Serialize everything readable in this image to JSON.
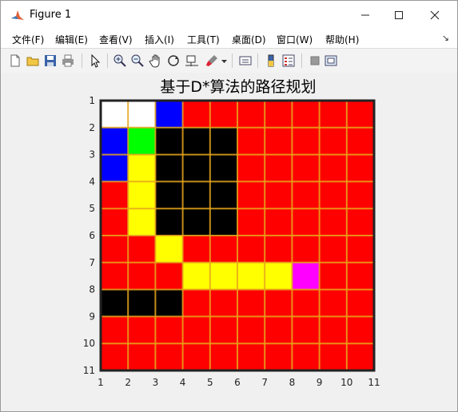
{
  "window": {
    "title": "Figure 1"
  },
  "menu": [
    "文件(F)",
    "编辑(E)",
    "查看(V)",
    "插入(I)",
    "工具(T)",
    "桌面(D)",
    "窗口(W)",
    "帮助(H)"
  ],
  "toolbar_icons": [
    "new-figure-icon",
    "open-file-icon",
    "save-icon",
    "print-icon",
    "pointer-icon",
    "zoom-in-icon",
    "zoom-out-icon",
    "pan-icon",
    "rotate-3d-icon",
    "data-cursor-icon",
    "brush-icon",
    "brush-dropdown-icon",
    "link-plot-icon",
    "insert-colorbar-icon",
    "insert-legend-icon",
    "hide-plot-tools-icon",
    "show-plot-tools-icon"
  ],
  "plot": {
    "title": "基于D*算法的路径规划",
    "x_ticks": [
      "1",
      "2",
      "3",
      "4",
      "5",
      "6",
      "7",
      "8",
      "9",
      "10",
      "11"
    ],
    "y_ticks": [
      "1",
      "2",
      "3",
      "4",
      "5",
      "6",
      "7",
      "8",
      "9",
      "10",
      "11"
    ],
    "colors": {
      "W": "#ffffff",
      "B": "#0000ff",
      "G": "#00ff00",
      "K": "#000000",
      "Y": "#ffff00",
      "M": "#ff00ff",
      "R": "#ff0000",
      "grid": "#e6a61c",
      "axis": "#222222"
    },
    "grid_rows": [
      "WWBRRRRRRR",
      "BGKKKRRRRR",
      "BYKKKRRRRR",
      "RYKKKRRRRR",
      "RYKKKRRRRR",
      "RRYRRRRRRR",
      "RRRYYYYMRR",
      "KKKRRRRRRR",
      "RRRRRRRRRR",
      "RRRRRRRRRR"
    ]
  }
}
